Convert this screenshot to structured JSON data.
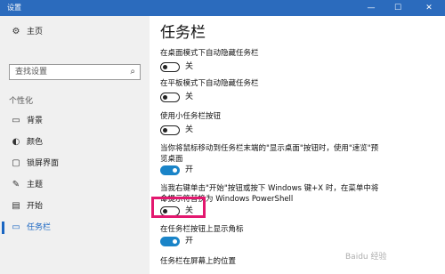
{
  "window": {
    "title": "设置",
    "min_glyph": "—",
    "max_glyph": "☐",
    "close_glyph": "✕"
  },
  "sidebar": {
    "home": {
      "label": "主页",
      "icon": "gear-icon"
    },
    "search_placeholder": "查找设置",
    "section": "个性化",
    "items": [
      {
        "label": "背景",
        "icon": "picture-icon"
      },
      {
        "label": "颜色",
        "icon": "palette-icon"
      },
      {
        "label": "锁屏界面",
        "icon": "lock-screen-icon"
      },
      {
        "label": "主题",
        "icon": "brush-icon"
      },
      {
        "label": "开始",
        "icon": "start-icon"
      },
      {
        "label": "任务栏",
        "icon": "taskbar-icon",
        "active": true
      }
    ]
  },
  "main": {
    "title": "任务栏",
    "settings": [
      {
        "label": "在桌面模式下自动隐藏任务栏",
        "state": "关",
        "on": false
      },
      {
        "label": "在平板模式下自动隐藏任务栏",
        "state": "关",
        "on": false
      },
      {
        "label": "使用小任务栏按钮",
        "state": "关",
        "on": false
      },
      {
        "label_line1": "当你将鼠标移动到任务栏末端的\"显示桌面\"按钮时，使用\"速览\"预",
        "label_line2": "览桌面",
        "state": "开",
        "on": true
      },
      {
        "label_line1": "当我右键单击\"开始\"按钮或按下 Windows 键+X 时，在菜单中将命",
        "label_line2": "令提示符替换为 Windows PowerShell",
        "state": "关",
        "on": false
      },
      {
        "label": "在任务栏按钮上显示角标",
        "state": "开",
        "on": true
      }
    ],
    "next_heading": "任务栏在屏幕上的位置"
  },
  "watermark": "Baidu 经验",
  "colors": {
    "accent": "#1a66c2",
    "titlebar": "#2b6bbd",
    "highlight": "#e3186f",
    "toggle_on": "#1a84c8"
  }
}
